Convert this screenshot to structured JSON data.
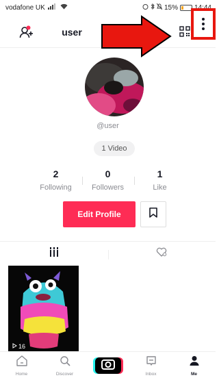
{
  "status_bar": {
    "carrier": "vodafone UK",
    "battery": "15%",
    "time": "14:44"
  },
  "header": {
    "username": "user"
  },
  "profile": {
    "handle": "@user",
    "video_count_label": "1 Video",
    "stats": [
      {
        "value": "2",
        "label": "Following"
      },
      {
        "value": "0",
        "label": "Followers"
      },
      {
        "value": "1",
        "label": "Like"
      }
    ],
    "edit_label": "Edit Profile"
  },
  "videos": [
    {
      "plays": "16"
    }
  ],
  "bottom_nav": {
    "home": "Home",
    "discover": "Discover",
    "inbox": "Inbox",
    "me": "Me"
  },
  "colors": {
    "accent": "#fe2c55",
    "annotation": "#e8170f"
  }
}
